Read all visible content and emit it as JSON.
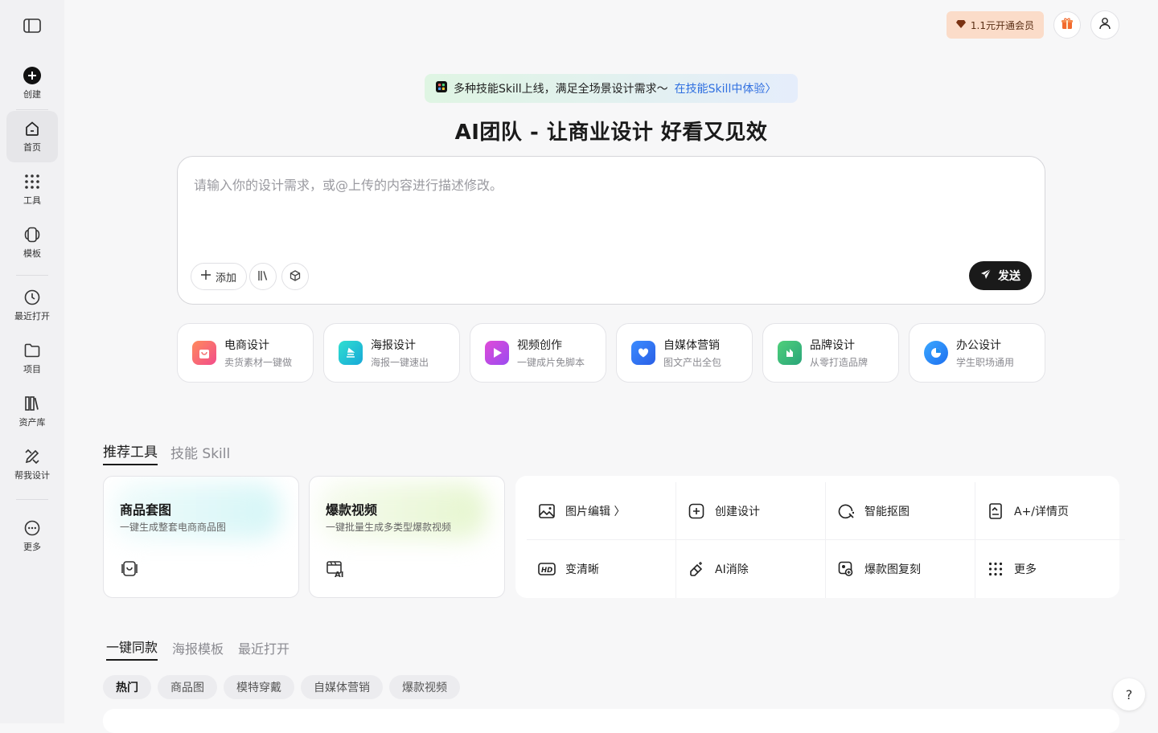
{
  "sidebar": {
    "items": [
      {
        "label": "创建",
        "icon": "plus-circle-icon"
      },
      {
        "label": "首页",
        "icon": "home-icon"
      },
      {
        "label": "工具",
        "icon": "grid-dots-icon"
      },
      {
        "label": "模板",
        "icon": "template-icon"
      },
      {
        "label": "最近打开",
        "icon": "clock-icon"
      },
      {
        "label": "项目",
        "icon": "folder-icon"
      },
      {
        "label": "资产库",
        "icon": "library-icon"
      },
      {
        "label": "帮我设计",
        "icon": "design-pencil-icon"
      },
      {
        "label": "更多",
        "icon": "more-circle-icon"
      }
    ]
  },
  "topbar": {
    "vip_label": "1.1元开通会员"
  },
  "banner": {
    "text": "多种技能Skill上线，满足全场景设计需求～",
    "link": "在技能Skill中体验〉"
  },
  "headline": "AI团队 - 让商业设计 好看又见效",
  "composer": {
    "placeholder": "请输入你的设计需求，或@上传的内容进行描述修改。",
    "add_label": "添加",
    "send_label": "发送"
  },
  "categories": [
    {
      "title": "电商设计",
      "sub": "卖货素材一键做",
      "color": "#f26d6d"
    },
    {
      "title": "海报设计",
      "sub": "海报一键速出",
      "color": "#1fc7c7"
    },
    {
      "title": "视频创作",
      "sub": "一键成片免脚本",
      "color": "#c64be0"
    },
    {
      "title": "自媒体营销",
      "sub": "图文产出全包",
      "color": "#2f7df2"
    },
    {
      "title": "品牌设计",
      "sub": "从零打造品牌",
      "color": "#39b86a"
    },
    {
      "title": "办公设计",
      "sub": "学生职场通用",
      "color": "#1e8df0"
    }
  ],
  "tools_tabs": [
    "推荐工具",
    "技能 Skill"
  ],
  "featured": [
    {
      "title": "商品套图",
      "sub": "一键生成整套电商商品图"
    },
    {
      "title": "爆款视频",
      "sub": "一键批量生成多类型爆款视频"
    }
  ],
  "tools": [
    {
      "label": "图片编辑 〉",
      "icon": "image-edit-icon"
    },
    {
      "label": "创建设计",
      "icon": "plus-square-icon"
    },
    {
      "label": "智能抠图",
      "icon": "cutout-icon"
    },
    {
      "label": "A+/详情页",
      "icon": "detail-page-icon"
    },
    {
      "label": "变清晰",
      "icon": "hd-icon"
    },
    {
      "label": "AI消除",
      "icon": "eraser-icon"
    },
    {
      "label": "爆款图复刻",
      "icon": "replicate-icon"
    },
    {
      "label": "更多",
      "icon": "grid-dots-icon"
    }
  ],
  "template_tabs": [
    "一键同款",
    "海报模板",
    "最近打开"
  ],
  "chips": [
    "热门",
    "商品图",
    "模特穿戴",
    "自媒体营销",
    "爆款视频"
  ],
  "help_label": "?"
}
